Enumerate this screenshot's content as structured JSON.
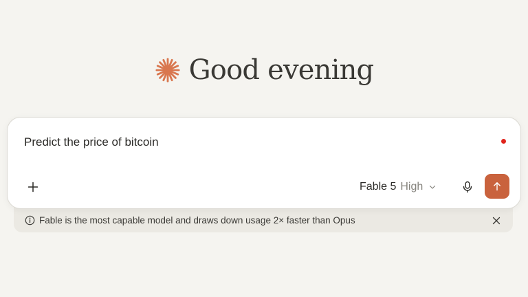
{
  "greeting": {
    "icon": "sparkle-icon",
    "icon_color": "#d9774f",
    "text": "Good evening"
  },
  "composer": {
    "prompt": "Predict the price of bitcoin",
    "recording_indicator_color": "#e0241c",
    "add_icon": "plus-icon",
    "model": {
      "name": "Fable 5",
      "effort": "High",
      "icon": "chevron-down-icon"
    },
    "mic_icon": "microphone-icon",
    "send": {
      "icon": "arrow-up-icon",
      "color": "#c9623d"
    }
  },
  "notice": {
    "icon": "info-icon",
    "text": "Fable is the most capable model and draws down usage 2× faster than Opus",
    "close_icon": "close-icon"
  }
}
